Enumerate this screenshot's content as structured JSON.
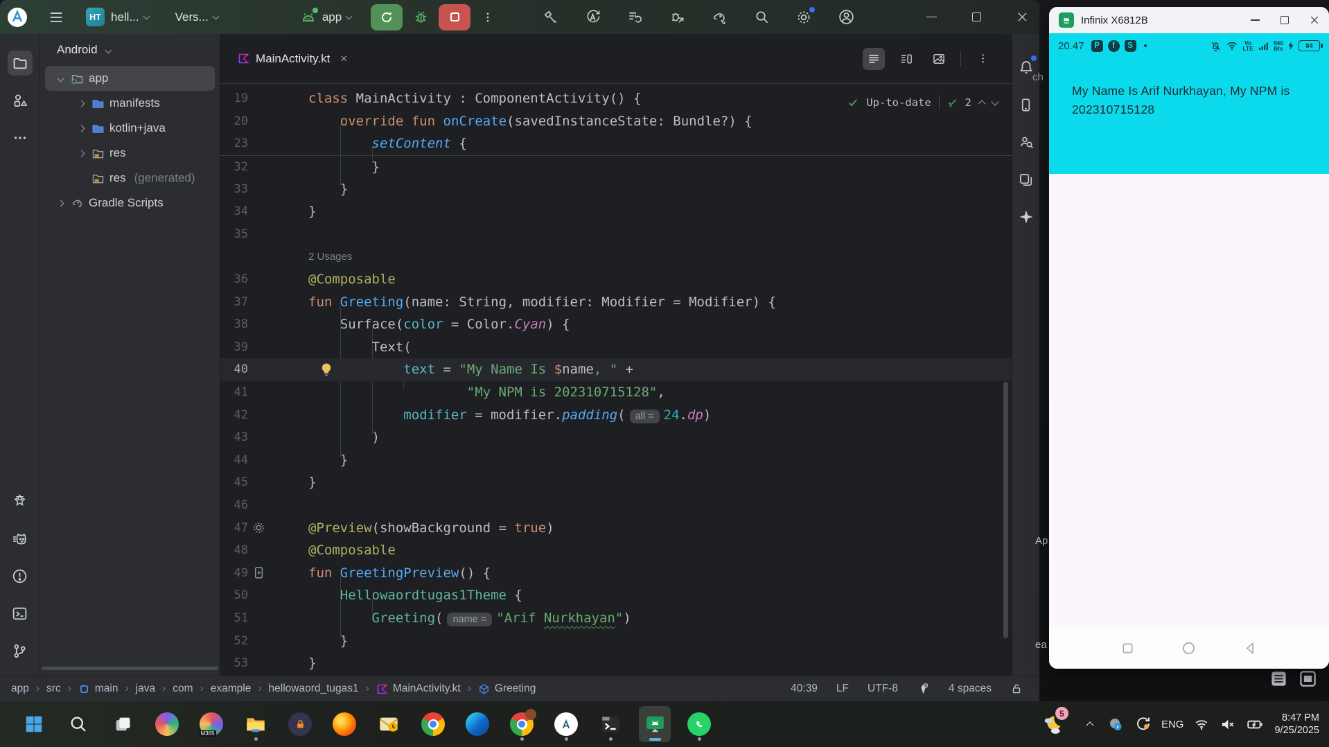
{
  "titlebar": {
    "project_badge": "HT",
    "project_name": "hell...",
    "vcs_branch": "Vers...",
    "run_target": "app"
  },
  "project": {
    "view": "Android",
    "items": [
      {
        "label": "app",
        "level": 0,
        "chev": "d",
        "icon": "appmodule",
        "selected": true
      },
      {
        "label": "manifests",
        "level": 1,
        "chev": "r",
        "icon": "folderb"
      },
      {
        "label": "kotlin+java",
        "level": 1,
        "chev": "r",
        "icon": "folderb"
      },
      {
        "label": "res",
        "level": 1,
        "chev": "r",
        "icon": "folderr"
      },
      {
        "label": "res",
        "suffix": "(generated)",
        "level": 1,
        "chev": "",
        "icon": "folderr"
      },
      {
        "label": "Gradle Scripts",
        "level": 0,
        "chev": "r",
        "icon": "gradle"
      }
    ]
  },
  "tab": {
    "file": "MainActivity.kt",
    "close": "×"
  },
  "inspect": {
    "uptodate": "Up-to-date",
    "count": "2"
  },
  "editor": {
    "lines": [
      {
        "num": "19",
        "segs": [
          [
            "kw",
            "class"
          ],
          [
            "pl",
            " MainActivity : ComponentActivity() {"
          ]
        ]
      },
      {
        "num": "20",
        "segs": [
          [
            "pl",
            "    "
          ],
          [
            "kw",
            "override"
          ],
          [
            "pl",
            " "
          ],
          [
            "kw",
            "fun"
          ],
          [
            "pl",
            " "
          ],
          [
            "fn",
            "onCreate"
          ],
          [
            "pl",
            "(savedInstanceState: Bundle?) {"
          ]
        ]
      },
      {
        "num": "23",
        "segs": [
          [
            "pl",
            "        "
          ],
          [
            "fni",
            "setContent"
          ],
          [
            "pl",
            " {"
          ]
        ]
      },
      {
        "num": "32",
        "sep": true,
        "segs": [
          [
            "pl",
            "        }"
          ]
        ]
      },
      {
        "num": "33",
        "segs": [
          [
            "pl",
            "    }"
          ]
        ]
      },
      {
        "num": "34",
        "segs": [
          [
            "pl",
            "}"
          ]
        ]
      },
      {
        "num": "35",
        "segs": []
      },
      {
        "usages": true,
        "text": "2 Usages"
      },
      {
        "num": "36",
        "segs": [
          [
            "ann",
            "@Composable"
          ]
        ]
      },
      {
        "num": "37",
        "segs": [
          [
            "kw",
            "fun"
          ],
          [
            "pl",
            " "
          ],
          [
            "fn",
            "Greeting"
          ],
          [
            "pl",
            "(name: String, modifier: Modifier = Modifier) {"
          ]
        ]
      },
      {
        "num": "38",
        "segs": [
          [
            "pl",
            "    Surface("
          ],
          [
            "named",
            "color"
          ],
          [
            "pl",
            " = Color."
          ],
          [
            "prop",
            "Cyan"
          ],
          [
            "pl",
            ") {"
          ]
        ]
      },
      {
        "num": "39",
        "segs": [
          [
            "pl",
            "        Text("
          ]
        ]
      },
      {
        "num": "40",
        "current": true,
        "bulb": true,
        "segs": [
          [
            "pl",
            "            "
          ],
          [
            "named",
            "text"
          ],
          [
            "pl",
            " = "
          ],
          [
            "str",
            "\"My Name Is "
          ],
          [
            "tpl",
            "$"
          ],
          [
            "pl",
            "name"
          ],
          [
            "str",
            ", \""
          ],
          [
            "pl",
            " +"
          ]
        ]
      },
      {
        "num": "41",
        "segs": [
          [
            "pl",
            "                    "
          ],
          [
            "str",
            "\"My NPM is 202310715128\""
          ],
          [
            "pl",
            ","
          ]
        ]
      },
      {
        "num": "42",
        "segs": [
          [
            "pl",
            "            "
          ],
          [
            "named",
            "modifier"
          ],
          [
            "pl",
            " = modifier."
          ],
          [
            "fni",
            "padding"
          ],
          [
            "pl",
            "("
          ],
          [
            "chip",
            "all ="
          ],
          [
            "num",
            "24"
          ],
          [
            "pl",
            "."
          ],
          [
            "prop",
            "dp"
          ],
          [
            "pl",
            ")"
          ]
        ]
      },
      {
        "num": "43",
        "segs": [
          [
            "pl",
            "        )"
          ]
        ]
      },
      {
        "num": "44",
        "segs": [
          [
            "pl",
            "    }"
          ]
        ]
      },
      {
        "num": "45",
        "segs": [
          [
            "pl",
            "}"
          ]
        ]
      },
      {
        "num": "46",
        "segs": []
      },
      {
        "num": "47",
        "gutter": "gear",
        "segs": [
          [
            "ann",
            "@Preview"
          ],
          [
            "pl",
            "(showBackground = "
          ],
          [
            "kw",
            "true"
          ],
          [
            "pl",
            ")"
          ]
        ]
      },
      {
        "num": "48",
        "segs": [
          [
            "ann",
            "@Composable"
          ]
        ]
      },
      {
        "num": "49",
        "gutter": "run",
        "segs": [
          [
            "kw",
            "fun"
          ],
          [
            "pl",
            " "
          ],
          [
            "fn",
            "GreetingPreview"
          ],
          [
            "pl",
            "() {"
          ]
        ]
      },
      {
        "num": "50",
        "segs": [
          [
            "pl",
            "    "
          ],
          [
            "comp",
            "Hellowaordtugas1Theme"
          ],
          [
            "pl",
            " {"
          ]
        ]
      },
      {
        "num": "51",
        "segs": [
          [
            "pl",
            "        "
          ],
          [
            "comp",
            "Greeting"
          ],
          [
            "pl",
            "("
          ],
          [
            "chip",
            "name ="
          ],
          [
            "str",
            "\"Arif "
          ],
          [
            "sq",
            "Nurkhayan"
          ],
          [
            "str",
            "\""
          ],
          [
            "pl",
            ")"
          ]
        ]
      },
      {
        "num": "52",
        "segs": [
          [
            "pl",
            "    }"
          ]
        ]
      },
      {
        "num": "53",
        "segs": [
          [
            "pl",
            "}"
          ]
        ]
      }
    ],
    "guides": [
      {
        "c": 4,
        "f": 1.65,
        "t": 4.35
      },
      {
        "c": 8,
        "f": 2.65,
        "t": 3.35
      },
      {
        "c": 4,
        "f": 9.65,
        "t": 16.35
      },
      {
        "c": 8,
        "f": 10.65,
        "t": 15.35
      },
      {
        "c": 12,
        "f": 12.65,
        "t": 13.35
      },
      {
        "c": 4,
        "f": 21.65,
        "t": 24.35
      },
      {
        "c": 8,
        "f": 22.65,
        "t": 23.35
      }
    ]
  },
  "breadcrumbs": [
    {
      "label": "app"
    },
    {
      "label": "src"
    },
    {
      "label": "main",
      "icon": "module"
    },
    {
      "label": "java"
    },
    {
      "label": "com"
    },
    {
      "label": "example"
    },
    {
      "label": "hellowaord_tugas1"
    },
    {
      "label": "MainActivity.kt",
      "icon": "kotlin"
    },
    {
      "label": "Greeting",
      "icon": "cube"
    }
  ],
  "statusbar": {
    "position": "40:39",
    "eol": "LF",
    "encoding": "UTF-8",
    "indent": "4 spaces"
  },
  "fragments": {
    "f1": "ch",
    "f2": "Ap",
    "f3": "ea"
  },
  "device": {
    "window_title": "Infinix X6812B",
    "status": {
      "time": "20.47",
      "volte_top": "Vo",
      "volte_bottom": "LTE",
      "net_up": "840",
      "net_unit": "B/s",
      "battery": "84"
    },
    "app_lines": {
      "line1": "My Name Is Arif Nurkhayan, My NPM is",
      "line2": "202310715128"
    }
  },
  "taskbar": {
    "m365_label": "M365"
  },
  "tray": {
    "badge": "5",
    "lang": "ENG",
    "time": "8:47 PM",
    "date": "9/25/2025"
  },
  "colors": {
    "run_green": "#549159",
    "stop_red": "#C75450",
    "device_cyan": "#0BDAEC",
    "accent_blue": "#3574F0"
  }
}
